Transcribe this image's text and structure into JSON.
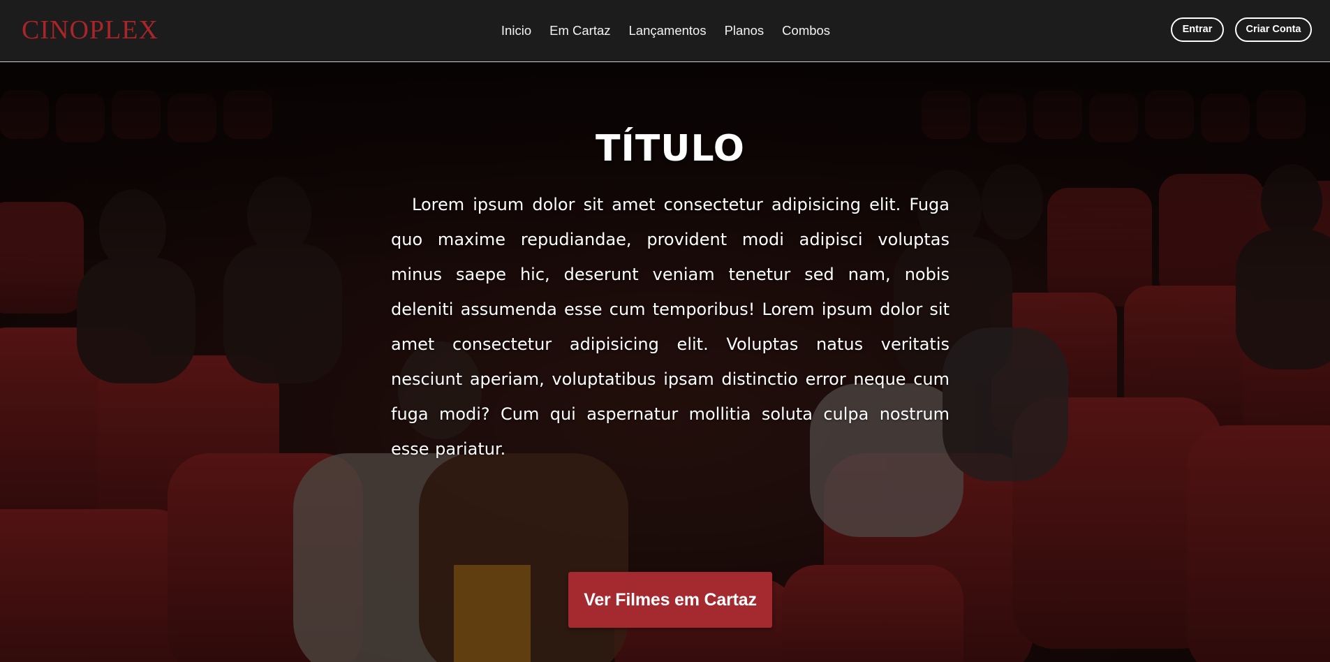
{
  "header": {
    "logo": "CINOPLEX",
    "nav": [
      "Inicio",
      "Em Cartaz",
      "Lançamentos",
      "Planos",
      "Combos"
    ],
    "login_label": "Entrar",
    "signup_label": "Criar Conta"
  },
  "hero": {
    "title": "TÍTULO",
    "body": "Lorem ipsum dolor sit amet consectetur adipisicing elit. Fuga quo maxime repudiandae, provident modi adipisci voluptas minus saepe hic, deserunt veniam tenetur sed nam, nobis deleniti assumenda esse cum temporibus! Lorem ipsum dolor sit amet consectetur adipisicing elit. Voluptas natus veritatis nesciunt aperiam, voluptatibus ipsam distinctio error neque cum fuga modi? Cum qui aspernatur mollitia soluta culpa nostrum esse pariatur.",
    "cta_label": "Ver Filmes em Cartaz"
  },
  "colors": {
    "brand": "#a8252a",
    "cta": "#a52a2f",
    "header_bg": "#1c1c1c",
    "seat_red": "#7e1d1d"
  }
}
